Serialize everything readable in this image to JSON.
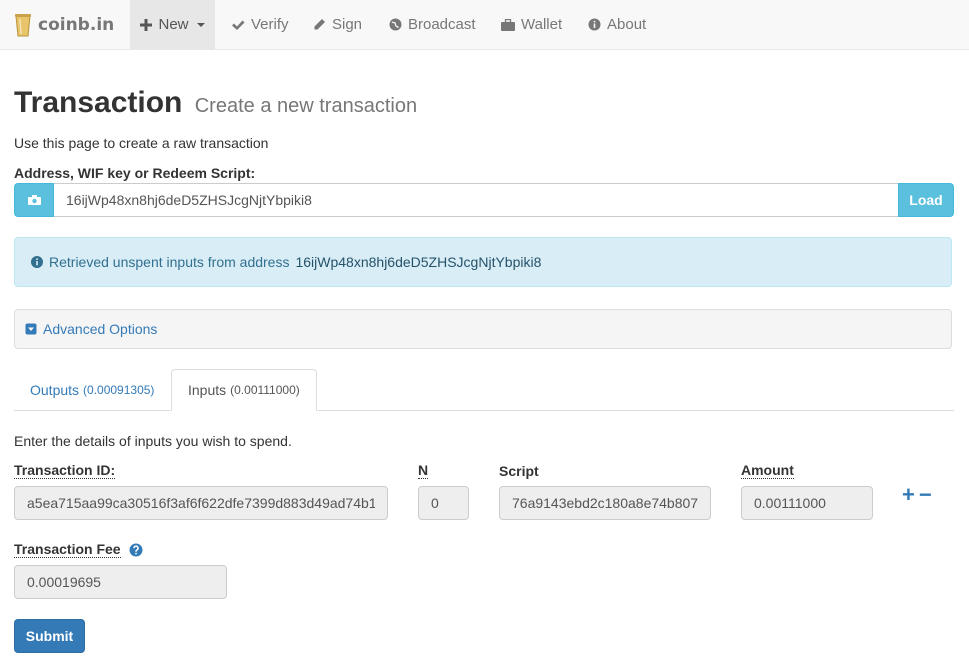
{
  "nav": {
    "brand": "coinb.in",
    "items": [
      {
        "label": "New",
        "icon": "plus-icon"
      },
      {
        "label": "Verify",
        "icon": "check-icon"
      },
      {
        "label": "Sign",
        "icon": "pencil-icon"
      },
      {
        "label": "Broadcast",
        "icon": "globe-icon"
      },
      {
        "label": "Wallet",
        "icon": "briefcase-icon"
      },
      {
        "label": "About",
        "icon": "info-icon"
      }
    ]
  },
  "page": {
    "title": "Transaction",
    "subtitle": "Create a new transaction",
    "lead": "Use this page to create a raw transaction"
  },
  "address": {
    "label": "Address, WIF key or Redeem Script:",
    "value": "16ijWp48xn8hj6deD5ZHSJcgNjtYbpiki8",
    "load_label": "Load"
  },
  "alert": {
    "text": "Retrieved unspent inputs from address",
    "address": "16ijWp48xn8hj6deD5ZHSJcgNjtYbpiki8"
  },
  "advanced": {
    "label": "Advanced Options"
  },
  "tabs": [
    {
      "label": "Outputs",
      "amount": "(0.00091305)"
    },
    {
      "label": "Inputs",
      "amount": "(0.00111000)",
      "active": true
    }
  ],
  "inputs": {
    "help": "Enter the details of inputs you wish to spend.",
    "col_txid": "Transaction ID:",
    "col_n": "N",
    "col_script": "Script",
    "col_amount": "Amount",
    "row": {
      "txid": "a5ea715aa99ca30516f3af6f622dfe7399d883d49ad74b1",
      "n": "0",
      "script": "76a9143ebd2c180a8e74b807",
      "amount": "0.00111000"
    },
    "add_symbol": "+",
    "remove_symbol": "−"
  },
  "fee": {
    "label": "Transaction Fee",
    "value": "0.00019695"
  },
  "submit_label": "Submit",
  "colors": {
    "info": "#5bc0de",
    "primary": "#337ab7",
    "alert_bg": "#d9edf7"
  }
}
